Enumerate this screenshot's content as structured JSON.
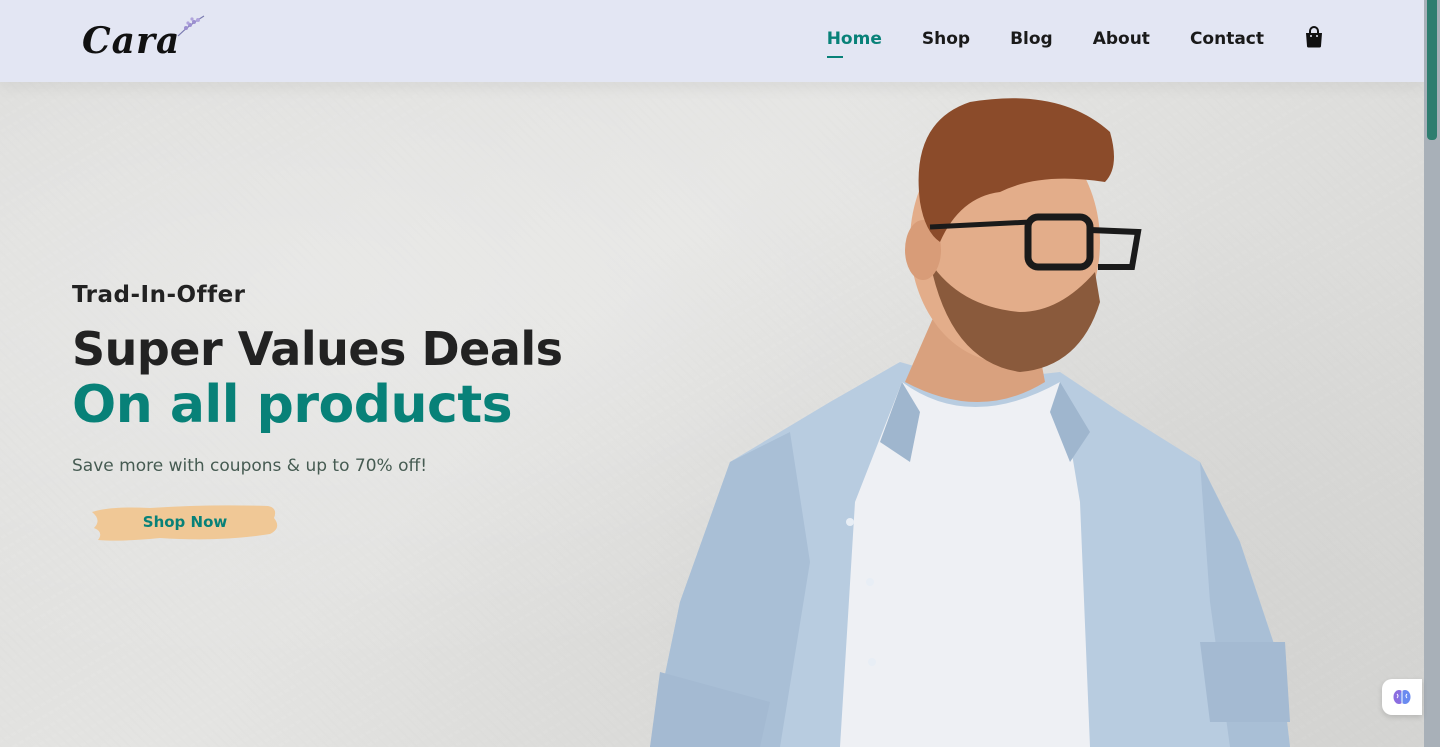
{
  "brand": {
    "logo_text": "Cara"
  },
  "nav": {
    "items": [
      {
        "label": "Home",
        "active": true
      },
      {
        "label": "Shop",
        "active": false
      },
      {
        "label": "Blog",
        "active": false
      },
      {
        "label": "About",
        "active": false
      },
      {
        "label": "Contact",
        "active": false
      }
    ],
    "cart_icon": "shopping-bag-icon"
  },
  "hero": {
    "eyebrow": "Trad-In-Offer",
    "headline": "Super Values Deals",
    "highlight": "On all products",
    "subtext": "Save more with coupons & up to 70% off!",
    "button_label": "Shop Now"
  },
  "colors": {
    "accent": "#088178",
    "header_bg": "#e3e6f3",
    "button_bg": "#f0c896"
  },
  "extension": {
    "icon": "brain-icon"
  }
}
